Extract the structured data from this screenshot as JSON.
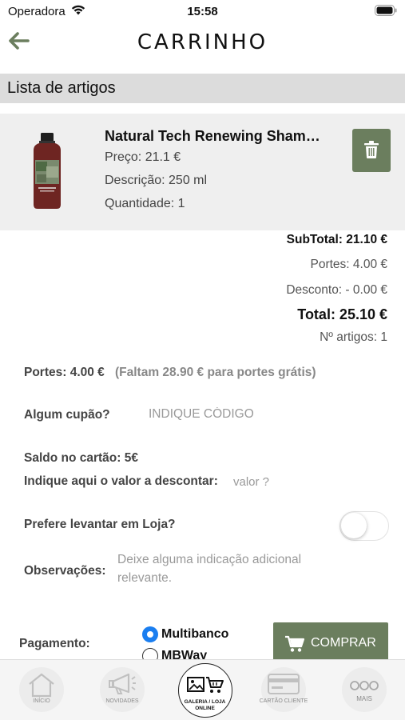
{
  "status_bar": {
    "carrier": "Operadora",
    "time": "15:58"
  },
  "header": {
    "title": "CARRINHO",
    "back_icon": "arrow-left-icon"
  },
  "section": {
    "title": "Lista de artigos"
  },
  "cart_items": [
    {
      "name": "Natural Tech Renewing Shampoo",
      "price": "Preço: 21.1 €",
      "description": "Descrição: 250 ml",
      "quantity": "Quantidade: 1"
    }
  ],
  "totals": {
    "subtotal": "SubTotal: 21.10 €",
    "portes": "Portes: 4.00 €",
    "desconto": "Desconto: - 0.00 €",
    "total": "Total: 25.10 €",
    "num_artigos": "Nº artigos: 1"
  },
  "info": {
    "portes_label": "Portes: 4.00 €",
    "portes_note": "(Faltam 28.90 € para portes grátis)",
    "cupao_label": "Algum cupão?",
    "cupao_placeholder": "INDIQUE CÓDIGO",
    "saldo_label": "Saldo no cartão: 5€",
    "desconto_label": "Indique aqui o valor a descontar:",
    "valor_placeholder": "valor ?",
    "levantar_label": "Prefere levantar em Loja?",
    "levantar_on": false,
    "obs_label": "Observações:",
    "obs_placeholder": "Deixe alguma indicação adicional relevante."
  },
  "payment": {
    "label": "Pagamento:",
    "options": [
      {
        "label": "Multibanco",
        "selected": true
      },
      {
        "label": "MBWay",
        "selected": false
      }
    ],
    "buy_button": "COMPRAR"
  },
  "tab_bar": {
    "tabs": [
      {
        "label": "INÍCIO",
        "icon": "home-icon"
      },
      {
        "label": "NOVIDADES",
        "icon": "megaphone-icon"
      },
      {
        "label": "GALERIA / LOJA ONLINE",
        "icon": "gallery-cart-icon"
      },
      {
        "label": "CARTÃO CLIENTE",
        "icon": "card-icon"
      },
      {
        "label": "MAIS",
        "icon": "more-icon"
      }
    ]
  },
  "colors": {
    "accent": "#6b7e5e",
    "radio_selected": "#1a7ef0",
    "section_bg": "#dcdcdc",
    "card_bg": "#efefef"
  }
}
